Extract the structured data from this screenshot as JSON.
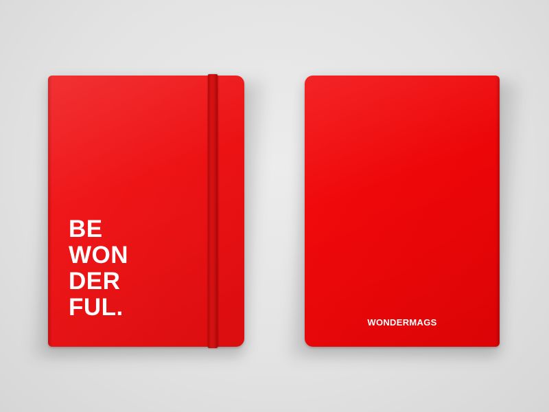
{
  "front_cover": {
    "slogan_lines": [
      "BE",
      "WON",
      "DER",
      "FUL."
    ]
  },
  "back_cover": {
    "brand": "WONDERMAGS"
  },
  "colors": {
    "background": "#e3e3e3",
    "cover_red": "#ee1416",
    "band_red": "#c90e10",
    "text": "#ffffff"
  }
}
